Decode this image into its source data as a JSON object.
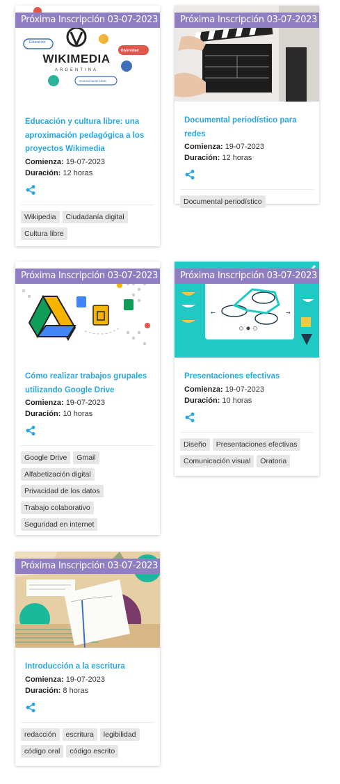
{
  "badge_prefix": "Próxima Inscripción",
  "labels": {
    "starts": "Comienza:",
    "duration": "Duración:"
  },
  "colors": {
    "badge": "#8f7fc2",
    "title": "#2aa7e0",
    "share": "#2aa7e0",
    "tag_bg": "#e6e6e6"
  },
  "courses": [
    {
      "badge_text": "Próxima Inscripción 03-07-2023",
      "thumb": {
        "brand": "WIKIMEDIA",
        "sub": "ARGENTINA",
        "chips": [
          "Educación",
          "Diversidad",
          "Conocimiento Libre"
        ]
      },
      "title": "Educación y cultura libre: una aproximación pedagógica a los proyectos Wikimedia",
      "starts": "19-07-2023",
      "duration": "12 horas",
      "tags": [
        "Wikipedia",
        "Ciudadanía digital",
        "Cultura libre"
      ]
    },
    {
      "badge_text": "Próxima Inscripción 03-07-2023",
      "title": "Documental periodístico para redes",
      "starts": "19-07-2023",
      "duration": "12 horas",
      "tags": [
        "Documental periodístico"
      ]
    },
    {
      "badge_text": "Próxima Inscripción 03-07-2023",
      "title": "Cómo realizar trabajos grupales utilizando Google Drive",
      "starts": "19-07-2023",
      "duration": "10 horas",
      "tags": [
        "Google Drive",
        "Gmail",
        "Alfabetización digital",
        "Privacidad de los datos",
        "Trabajo colaborativo",
        "Seguridad en internet"
      ]
    },
    {
      "badge_text": "Próxima Inscripción 03-07-2023",
      "title": "Presentaciones efectivas",
      "starts": "19-07-2023",
      "duration": "10 horas",
      "tags": [
        "Diseño",
        "Presentaciones efectivas",
        "Comunicación visual",
        "Oratoria"
      ]
    },
    {
      "badge_text": "Próxima Inscripción 03-07-2023",
      "title": "Introducción a la escritura",
      "starts": "19-07-2023",
      "duration": "8 horas",
      "tags": [
        "redacción",
        "escritura",
        "legibilidad",
        "código oral",
        "código escrito"
      ]
    }
  ]
}
